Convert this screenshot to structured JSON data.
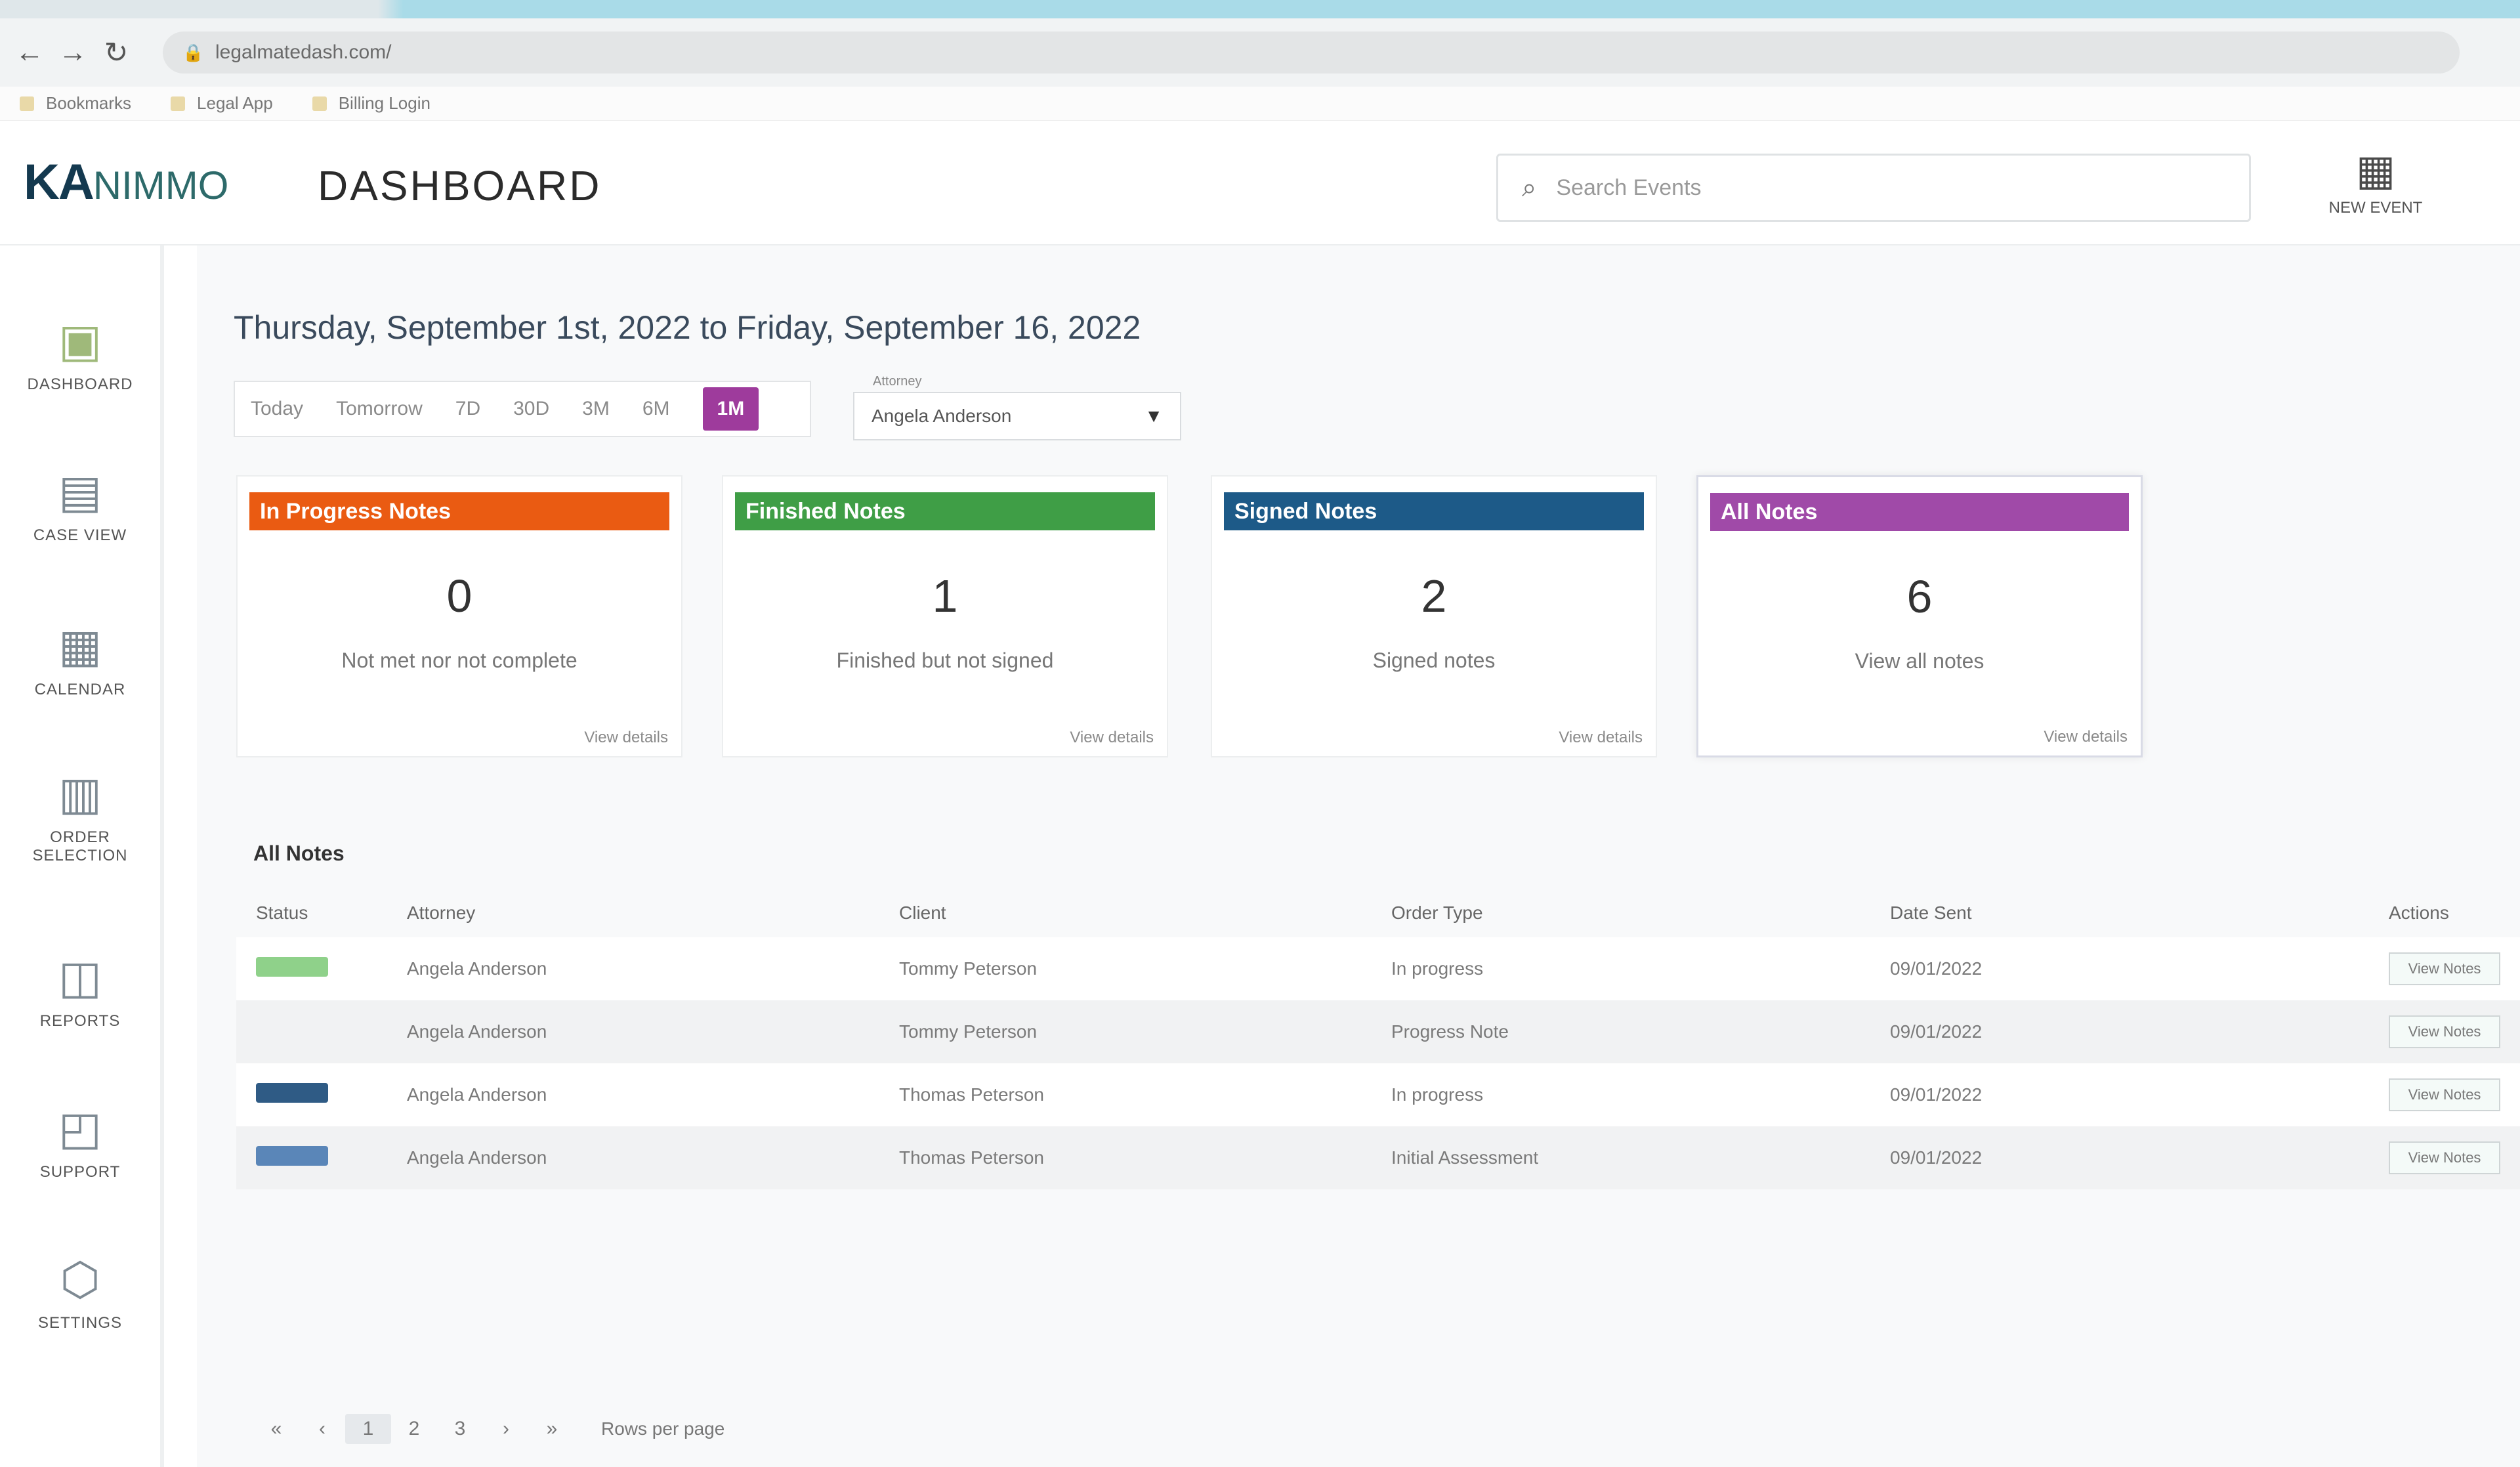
{
  "browser": {
    "url": "legalmatedash.com/",
    "bookmarks": [
      "Bookmarks",
      "Legal App",
      "Billing Login"
    ]
  },
  "header": {
    "logo_main": "KA",
    "logo_rest": "NIMMO",
    "title": "DASHBOARD",
    "search_placeholder": "Search Events",
    "new_event_label": "NEW EVENT"
  },
  "sidebar": {
    "items": [
      {
        "label": "DASHBOARD",
        "icon": "dashboard-icon"
      },
      {
        "label": "CASE VIEW",
        "icon": "case-view-icon"
      },
      {
        "label": "CALENDAR",
        "icon": "calendar-icon"
      },
      {
        "label": "ORDER SELECTION",
        "icon": "order-icon"
      },
      {
        "label": "REPORTS",
        "icon": "reports-icon"
      },
      {
        "label": "SUPPORT",
        "icon": "support-icon"
      },
      {
        "label": "SETTINGS",
        "icon": "settings-icon"
      }
    ]
  },
  "main": {
    "date_range": "Thursday, September 1st, 2022 to Friday, September 16, 2022",
    "filters": [
      "Today",
      "Tomorrow",
      "7D",
      "30D",
      "3M",
      "6M",
      "1M"
    ],
    "active_filter": "1M",
    "dropdown_caption": "Attorney",
    "dropdown_value": "Angela Anderson",
    "cards": [
      {
        "title": "In Progress Notes",
        "count": "0",
        "desc": "Not met nor not complete",
        "link": "View details",
        "color": "#ea5b12"
      },
      {
        "title": "Finished Notes",
        "count": "1",
        "desc": "Finished but not signed",
        "link": "View details",
        "color": "#3f9e46"
      },
      {
        "title": "Signed Notes",
        "count": "2",
        "desc": "Signed notes",
        "link": "View details",
        "color": "#1d5a88"
      },
      {
        "title": "All Notes",
        "count": "6",
        "desc": "View all notes",
        "link": "View details",
        "color": "#a04aa8"
      }
    ],
    "table": {
      "title": "All Notes",
      "columns": [
        "Status",
        "Attorney",
        "Client",
        "Order Type",
        "Date Sent",
        "Actions"
      ],
      "rows": [
        {
          "status": "green",
          "attorney": "Angela Anderson",
          "client": "Tommy Peterson",
          "order": "In progress",
          "date": "09/01/2022",
          "action": "View Notes"
        },
        {
          "status": "",
          "attorney": "Angela Anderson",
          "client": "Tommy Peterson",
          "order": "Progress Note",
          "date": "09/01/2022",
          "action": "View Notes"
        },
        {
          "status": "navy",
          "attorney": "Angela Anderson",
          "client": "Thomas Peterson",
          "order": "In progress",
          "date": "09/01/2022",
          "action": "View Notes"
        },
        {
          "status": "blue",
          "attorney": "Angela Anderson",
          "client": "Thomas Peterson",
          "order": "Initial Assessment",
          "date": "09/01/2022",
          "action": "View Notes"
        }
      ]
    },
    "pager": {
      "pages": [
        "«",
        "‹",
        "1",
        "2",
        "3",
        "›",
        "»"
      ],
      "active": "1",
      "info": "Rows per page"
    }
  }
}
